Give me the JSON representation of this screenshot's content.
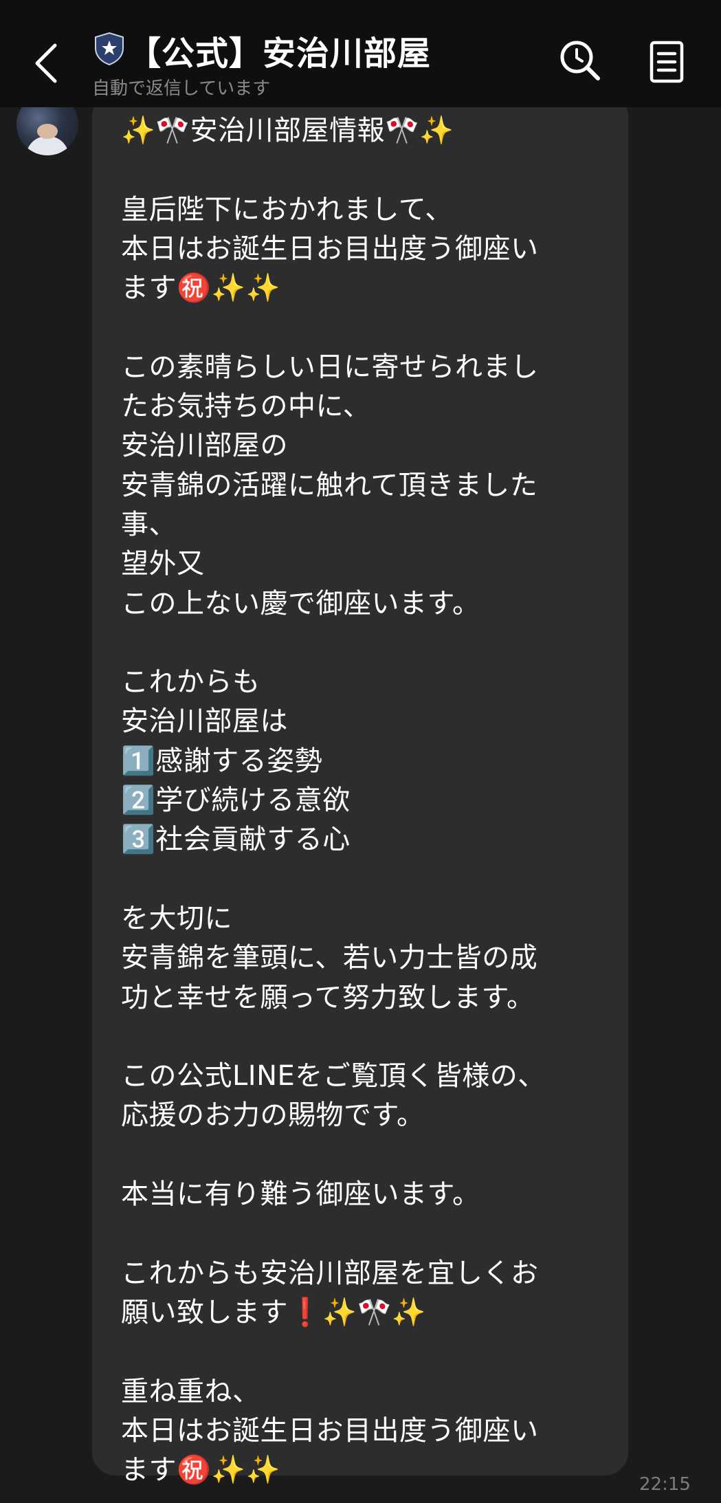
{
  "header": {
    "title": "【公式】安治川部屋",
    "subtitle": "自動で返信しています"
  },
  "icons": {
    "back": "chevron-left-icon",
    "official": "shield-star-icon",
    "search": "search-icon",
    "notes": "notes-icon"
  },
  "message": {
    "text": "✨🎌安治川部屋情報🎌✨\n\n皇后陛下におかれまして、\n本日はお誕生日お目出度う御座い\nます㊗️✨✨\n\nこの素晴らしい日に寄せられまし\nたお気持ちの中に、\n安治川部屋の\n安青錦の活躍に触れて頂きました\n事、\n望外又\nこの上ない慶で御座います。\n\nこれからも\n安治川部屋は\n1️⃣感謝する姿勢\n2️⃣学び続ける意欲\n3️⃣社会貢献する心\n\nを大切に\n安青錦を筆頭に、若い力士皆の成\n功と幸せを願って努力致します。\n\nこの公式LINEをご覧頂く皆様の、\n応援のお力の賜物です。\n\n本当に有り難う御座います。\n\nこれからも安治川部屋を宜しくお\n願い致します❗️✨🎌✨\n\n重ね重ね、\n本日はお誕生日お目出度う御座い\nます㊗️✨✨",
    "time": "22:15"
  },
  "colors": {
    "header_bg": "#0f0f0f",
    "chat_bg": "#1b1b1b",
    "bubble_bg": "#2d2d2d",
    "text": "#ffffff",
    "muted": "#8a8a8a"
  }
}
